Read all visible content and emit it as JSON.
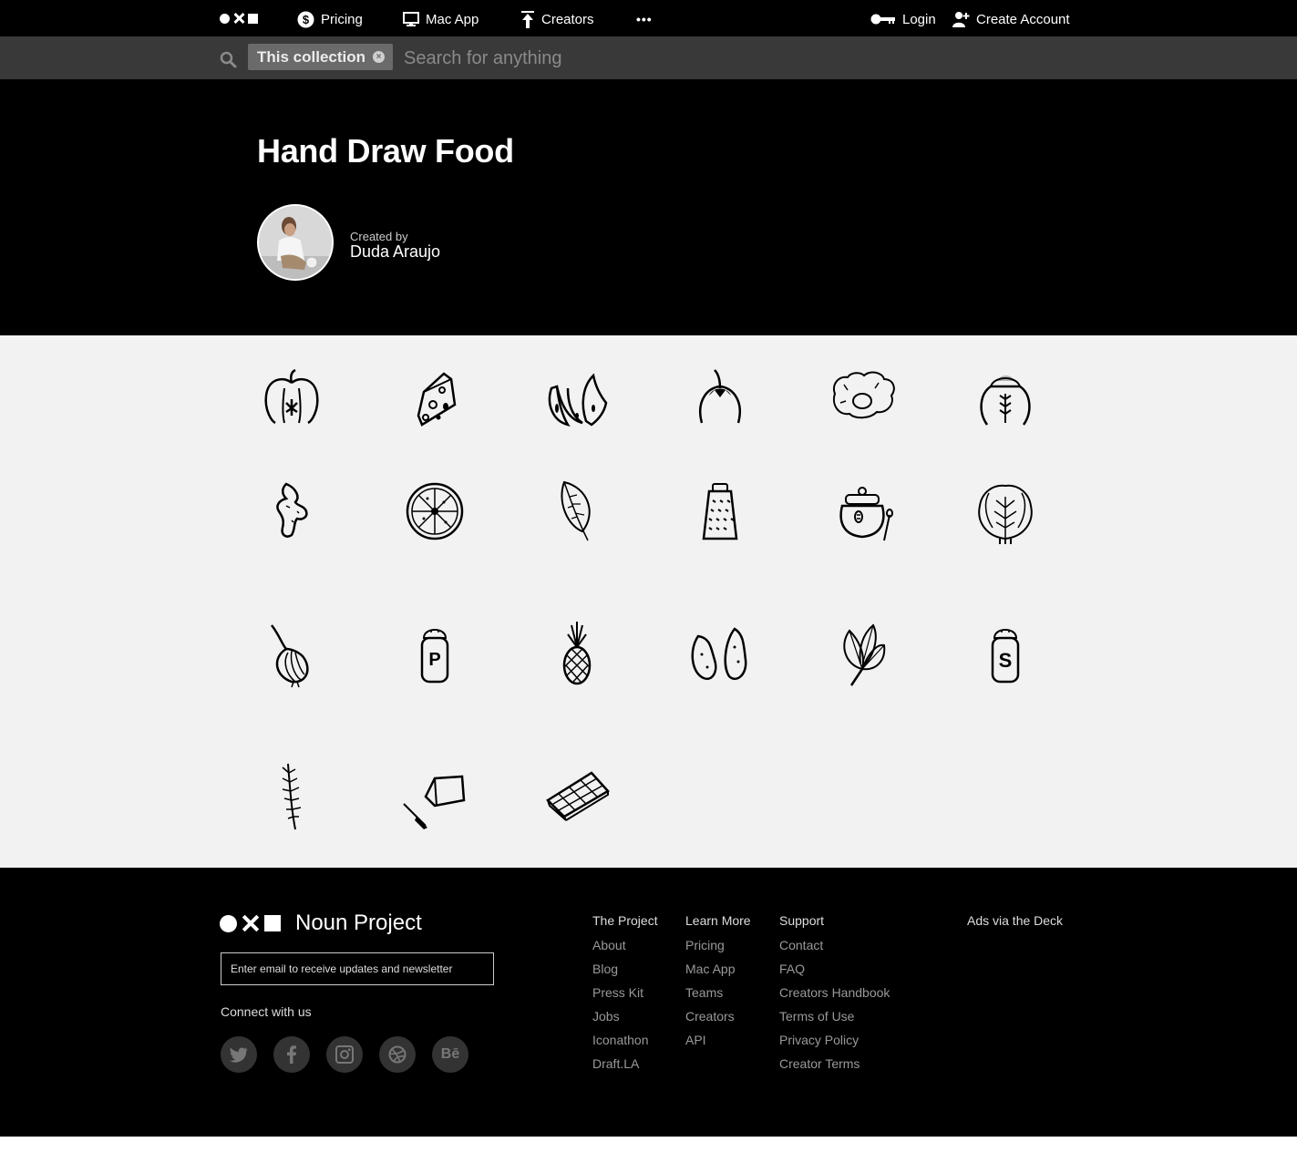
{
  "topnav": {
    "pricing": "Pricing",
    "mac_app": "Mac App",
    "creators": "Creators",
    "more": "•••",
    "login": "Login",
    "create_account": "Create Account"
  },
  "search": {
    "chip_label": "This collection",
    "chip_clear": "×",
    "placeholder": "Search for anything"
  },
  "collection": {
    "title": "Hand Draw Food",
    "created_by_label": "Created by",
    "author": "Duda Araujo"
  },
  "icons": [
    "apple",
    "cheese",
    "bananas",
    "eggplant",
    "fried-egg",
    "flour-sack",
    "ginger",
    "citrus-slice",
    "leaf",
    "grater",
    "honey-pot",
    "cabbage",
    "onion",
    "pepper-shaker",
    "pineapple",
    "potatoes",
    "spinach",
    "salt-shaker",
    "rosemary",
    "butter",
    "chocolate-bar"
  ],
  "footer": {
    "brand": "Noun Project",
    "newsletter_placeholder": "Enter email to receive updates and newsletter",
    "connect": "Connect with us",
    "social": [
      {
        "name": "twitter-icon",
        "glyph": ""
      },
      {
        "name": "facebook-icon",
        "glyph": ""
      },
      {
        "name": "instagram-icon",
        "glyph": ""
      },
      {
        "name": "dribbble-icon",
        "glyph": ""
      },
      {
        "name": "behance-icon",
        "glyph": "Bē"
      }
    ],
    "col_project": {
      "head": "The Project",
      "links": [
        "About",
        "Blog",
        "Press Kit",
        "Jobs",
        "Iconathon",
        "Draft.LA"
      ]
    },
    "col_learn": {
      "head": "Learn More",
      "links": [
        "Pricing",
        "Mac App",
        "Teams",
        "Creators",
        "API"
      ]
    },
    "col_support": {
      "head": "Support",
      "links": [
        "Contact",
        "FAQ",
        "Creators Handbook",
        "Terms of Use",
        "Privacy Policy",
        "Creator Terms"
      ]
    },
    "ads": "Ads via the Deck"
  }
}
